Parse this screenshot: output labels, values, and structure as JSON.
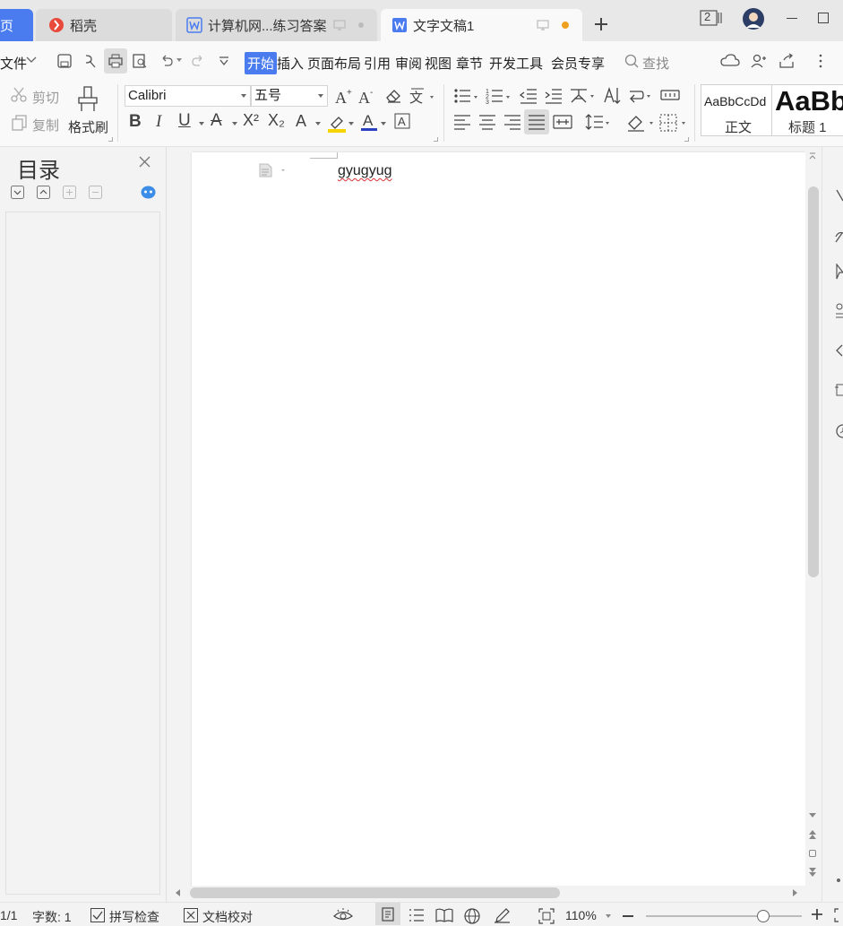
{
  "tabs": {
    "home": "页",
    "daoke": "稻壳",
    "doc1": "计算机网...练习答案",
    "doc2": "文字文稿1"
  },
  "window": {
    "badge_count": "2"
  },
  "menu": {
    "file": "文件",
    "items": [
      "开始",
      "插入",
      "页面布局",
      "引用",
      "审阅",
      "视图",
      "章节",
      "开发工具",
      "会员专享"
    ],
    "search": "查找"
  },
  "ribbon": {
    "cut": "剪切",
    "copy": "复制",
    "format_painter": "格式刷",
    "font_name": "Calibri",
    "font_size": "五号",
    "styles": [
      {
        "preview": "AaBbCcDd",
        "name": "正文"
      },
      {
        "preview": "AaBb",
        "name": "标题 1"
      }
    ]
  },
  "toc": {
    "title": "目录"
  },
  "document": {
    "text": "gyugyug"
  },
  "status": {
    "page": "1/1",
    "word_count": "字数: 1",
    "spell_check": "拼写检查",
    "doc_proof": "文档校对",
    "zoom": "110%",
    "zoom_fraction": 0.75
  },
  "colors": {
    "accent": "#4a7cf0",
    "highlight": "#f5d400",
    "font_color": "#2b3fc1",
    "modified_dot": "#f0a020"
  }
}
